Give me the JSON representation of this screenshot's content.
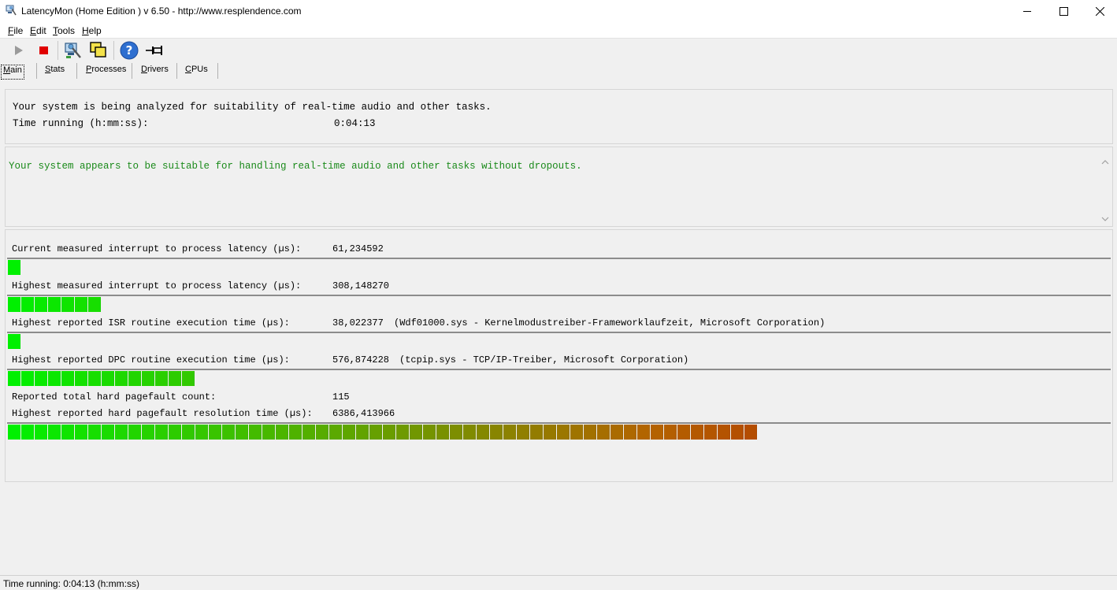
{
  "window": {
    "title": "LatencyMon  (Home Edition )  v 6.50 - http://www.resplendence.com"
  },
  "menu": [
    {
      "key": "F",
      "rest": "ile"
    },
    {
      "key": "E",
      "rest": "dit"
    },
    {
      "key": "T",
      "rest": "ools"
    },
    {
      "key": "H",
      "rest": "elp"
    }
  ],
  "toolbar": {
    "icons": [
      "play-icon",
      "stop-icon",
      "monitor-tool-icon",
      "windows-icon",
      "help-icon",
      "pin-icon"
    ]
  },
  "tabs": [
    {
      "key": "M",
      "rest": "ain",
      "active": true
    },
    {
      "key": "S",
      "rest": "tats",
      "active": false
    },
    {
      "key": "P",
      "rest": "rocesses",
      "active": false
    },
    {
      "key": "D",
      "rest": "rivers",
      "active": false
    },
    {
      "key": "C",
      "rest": "PUs",
      "active": false
    }
  ],
  "summary": {
    "line1": "Your system is being analyzed for suitability of real-time audio and other tasks.",
    "time_label": "Time running (h:mm:ss):",
    "time_value": "0:04:13"
  },
  "verdict": {
    "message": "Your system appears to be suitable for handling real-time audio and other tasks without dropouts."
  },
  "metrics": {
    "current_latency": {
      "label": "Current measured interrupt to process latency (µs):",
      "value": "61,234592",
      "detail": "",
      "segments": 1
    },
    "highest_latency": {
      "label": "Highest measured interrupt to process latency (µs):",
      "value": "308,148270",
      "detail": "",
      "segments": 7
    },
    "isr_time": {
      "label": "Highest reported ISR routine execution time (µs):",
      "value": "38,022377",
      "detail": "(Wdf01000.sys - Kernelmodustreiber-Frameworklaufzeit, Microsoft Corporation)",
      "segments": 1
    },
    "dpc_time": {
      "label": "Highest reported DPC routine execution time (µs):",
      "value": "576,874228",
      "detail": "(tcpip.sys - TCP/IP-Treiber, Microsoft Corporation)",
      "segments": 14
    },
    "pagefault_count": {
      "label": "Reported total hard pagefault count:",
      "value": "115"
    },
    "pagefault_time": {
      "label": "Highest reported hard pagefault resolution time (µs):",
      "value": "6386,413966",
      "detail": "",
      "segments": 56
    }
  },
  "colors": {
    "bar_start": "#00f000",
    "bar_end": "#b40000",
    "verdict_text": "#1a8a1a"
  },
  "statusbar": {
    "text": "Time running: 0:04:13  (h:mm:ss)"
  }
}
